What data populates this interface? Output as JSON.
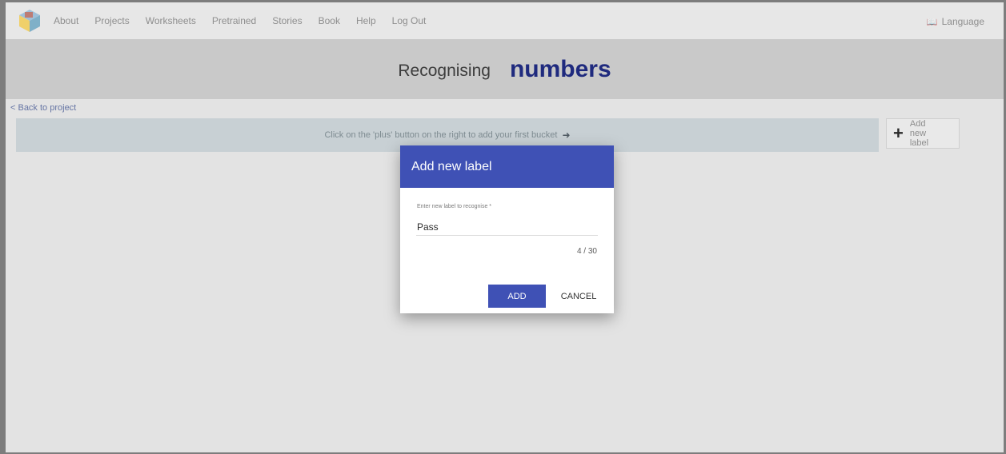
{
  "nav": {
    "logo_icon": "cube-logo-icon",
    "links": [
      "About",
      "Projects",
      "Worksheets",
      "Pretrained",
      "Stories",
      "Book",
      "Help",
      "Log Out"
    ],
    "language_icon": "language-icon",
    "language_label": "Language"
  },
  "header": {
    "prefix": "Recognising",
    "project_name": "numbers",
    "project_name_color": "#1f2a7e"
  },
  "back_link": "< Back to project",
  "hint": {
    "text": "Click on the 'plus' button on the right to add your first bucket",
    "arrow_icon": "arrow-right-icon"
  },
  "add_label_button": {
    "icon": "plus-icon",
    "label": "Add new label"
  },
  "dialog": {
    "title": "Add new label",
    "field_label": "Enter new label to recognise *",
    "field_value": "Pass",
    "char_count": "4 / 30",
    "add_label": "ADD",
    "cancel_label": "CANCEL",
    "accent_color": "#3f51b5"
  }
}
